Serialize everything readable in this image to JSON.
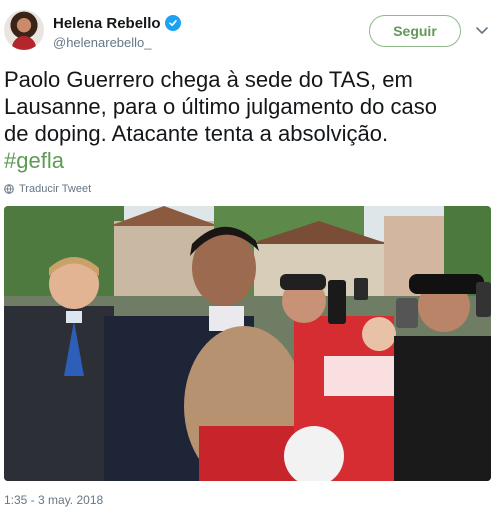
{
  "author": {
    "display_name": "Helena Rebello",
    "handle": "@helenarebello_",
    "verified_icon": "verified-badge-icon"
  },
  "actions": {
    "follow_label": "Seguir",
    "more_icon": "chevron-down-icon"
  },
  "tweet": {
    "lines": [
      "Paolo Guerrero chega à sede do TAS, em",
      "Lausanne, para o último julgamento do caso",
      "de doping. Atacante tenta a absolvição."
    ],
    "hashtag": "#gefla",
    "translate_label": "Traducir Tweet"
  },
  "meta": {
    "timestamp": "1:35 - 3 may. 2018"
  },
  "colors": {
    "accent_green": "#5f9a56",
    "verified_blue": "#1da1f2",
    "muted_text": "#657786"
  }
}
